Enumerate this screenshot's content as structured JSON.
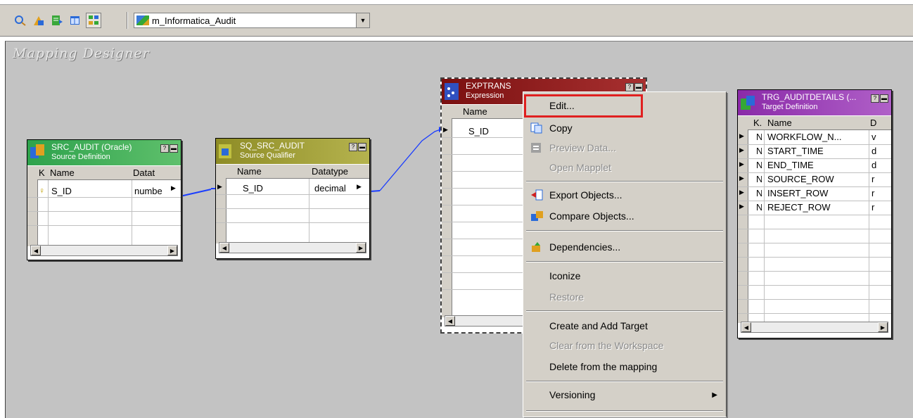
{
  "toolbar": {
    "buttons": [
      "source-analyzer-icon",
      "target-designer-icon",
      "transformation-developer-icon",
      "mapplet-designer-icon",
      "mapping-designer-icon"
    ],
    "mapping_select_value": "m_Informatica_Audit"
  },
  "workspace": {
    "title": "Mapping Designer"
  },
  "src_audit": {
    "title": "SRC_AUDIT (Oracle)",
    "subtitle": "Source Definition",
    "col_key": "K",
    "col_name": "Name",
    "col_datatype": "Datat",
    "rows": [
      {
        "name": "S_ID",
        "datatype": "numbe"
      }
    ]
  },
  "sq_src_audit": {
    "title": "SQ_SRC_AUDIT",
    "subtitle": "Source Qualifier",
    "col_name": "Name",
    "col_datatype": "Datatype",
    "rows": [
      {
        "name": "S_ID",
        "datatype": "decimal"
      }
    ]
  },
  "exptrans": {
    "title": "EXPTRANS",
    "subtitle": "Expression",
    "col_name": "Name",
    "rows": [
      {
        "name": "S_ID"
      }
    ]
  },
  "trg_auditdetails": {
    "title": "TRG_AUDITDETAILS (...",
    "subtitle": "Target Definition",
    "col_key": "K.",
    "col_name": "Name",
    "col_datatype": "D",
    "rows": [
      {
        "key": "N",
        "name": "WORKFLOW_N...",
        "dt": "v"
      },
      {
        "key": "N",
        "name": "START_TIME",
        "dt": "d"
      },
      {
        "key": "N",
        "name": "END_TIME",
        "dt": "d"
      },
      {
        "key": "N",
        "name": "SOURCE_ROW",
        "dt": "r"
      },
      {
        "key": "N",
        "name": "INSERT_ROW",
        "dt": "r"
      },
      {
        "key": "N",
        "name": "REJECT_ROW",
        "dt": "r"
      }
    ]
  },
  "context_menu": {
    "edit": "Edit...",
    "copy": "Copy",
    "preview_data": "Preview Data...",
    "open_mapplet": "Open Mapplet",
    "export_objects": "Export Objects...",
    "compare_objects": "Compare Objects...",
    "dependencies": "Dependencies...",
    "iconize": "Iconize",
    "restore": "Restore",
    "create_and_add_target": "Create and Add Target",
    "clear_from_workspace": "Clear from the Workspace",
    "delete_from_mapping": "Delete from the mapping",
    "versioning": "Versioning"
  },
  "colors": {
    "source_header": "#2ea24c",
    "sq_header": "#a6a43a",
    "expression_header": "#8c1a1a",
    "target_header": "#9a3fb0",
    "highlight": "#e02020",
    "link": "#1a3dff"
  }
}
